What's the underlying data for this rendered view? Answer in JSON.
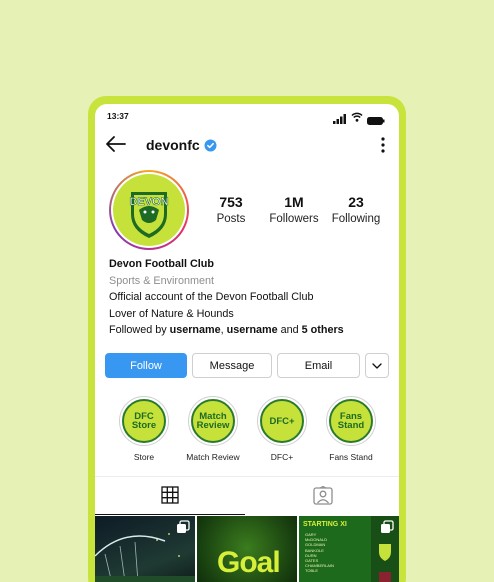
{
  "status_bar": {
    "time": "13:37"
  },
  "header": {
    "username": "devonfc",
    "verified": true
  },
  "profile": {
    "avatar_text": "DEVON",
    "stats": [
      {
        "value": "753",
        "label": "Posts"
      },
      {
        "value": "1M",
        "label": "Followers"
      },
      {
        "value": "23",
        "label": "Following"
      }
    ],
    "name": "Devon Football Club",
    "category": "Sports & Environment",
    "bio_lines": [
      "Official account of the Devon Football Club",
      "Lover of Nature & Hounds"
    ],
    "followed_by": {
      "prefix": "Followed by ",
      "user1": "username",
      "sep": ", ",
      "user2": "username",
      "and": " and ",
      "others": "5 others"
    }
  },
  "actions": {
    "follow": "Follow",
    "message": "Message",
    "email": "Email"
  },
  "highlights": [
    {
      "circle_text": "DFC\nStore",
      "label": "Store"
    },
    {
      "circle_text": "Match\nReview",
      "label": "Match Review"
    },
    {
      "circle_text": "DFC+",
      "label": "DFC+"
    },
    {
      "circle_text": "Fans\nStand",
      "label": "Fans Stand"
    }
  ],
  "tabs": [
    {
      "name": "grid",
      "icon": "grid-icon",
      "active": true
    },
    {
      "name": "tagged",
      "icon": "tagged-icon",
      "active": false
    }
  ],
  "posts": [
    {
      "type": "stadium-photo",
      "multi": true
    },
    {
      "type": "goal-graphic",
      "text": "Goal",
      "multi": false
    },
    {
      "type": "starting-xi",
      "title": "STARTING XI",
      "players": [
        "GARY",
        "McDONALD",
        "GOLDMAN",
        "BANKOLE",
        "DURN",
        "GATES",
        "CHAMBERLAIN",
        "TOBLE"
      ],
      "multi": true
    }
  ],
  "colors": {
    "background": "#e6f1b6",
    "phone_frame": "#c9e33d",
    "brand_lime": "#c6e23a",
    "brand_green": "#1d6a24",
    "follow_button": "#3897f0",
    "verified": "#3897f0"
  }
}
